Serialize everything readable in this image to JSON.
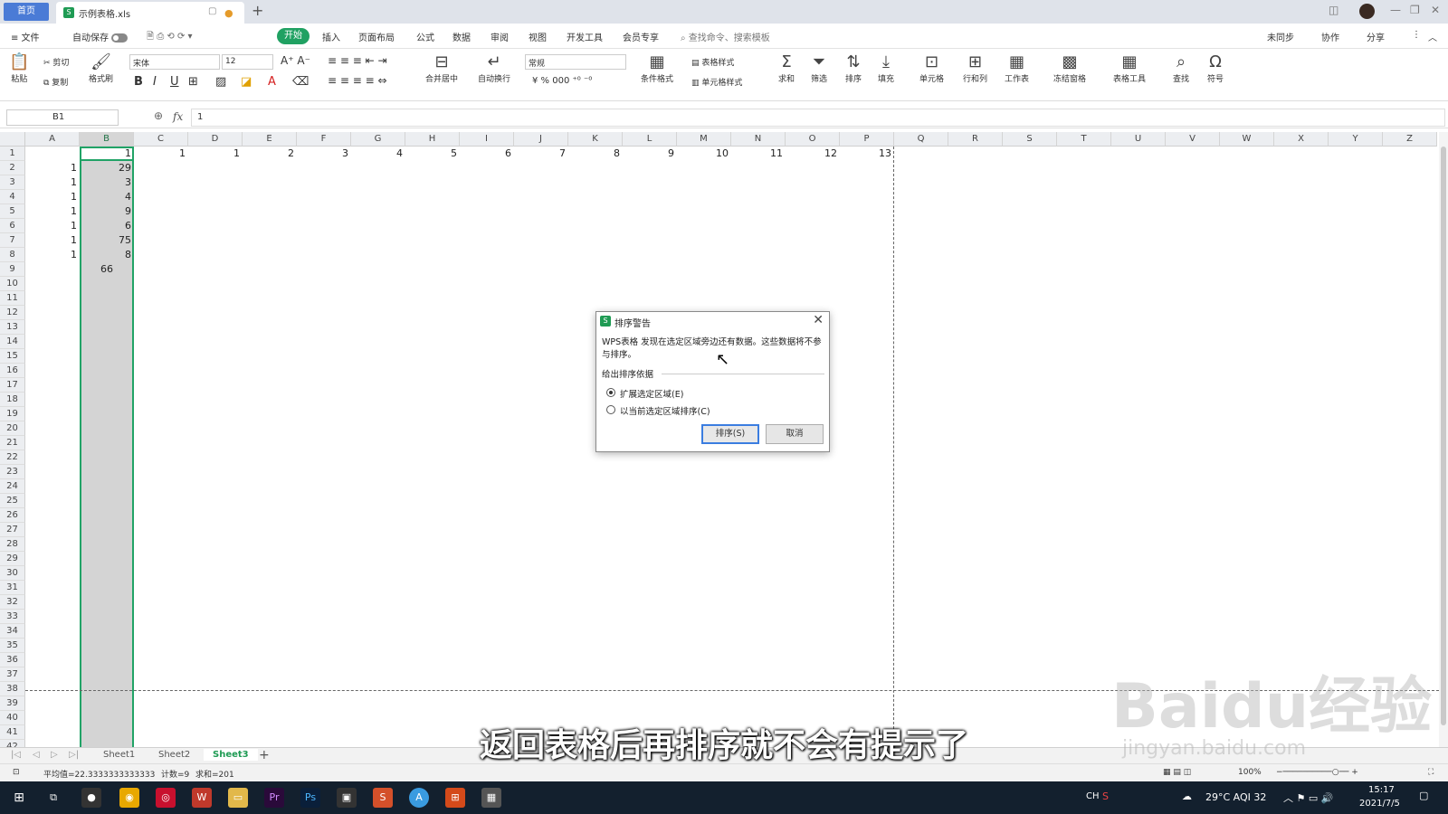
{
  "titlebar": {
    "home_tab": "首页",
    "doc_name": "示例表格.xls",
    "new_tab": "+"
  },
  "menubar": {
    "file": "≡ 文件",
    "autosave": "自动保存",
    "tabs": [
      "开始",
      "插入",
      "页面布局",
      "公式",
      "数据",
      "审阅",
      "视图",
      "开发工具",
      "会员专享"
    ],
    "search": "查找命令、搜索模板",
    "right": [
      "未同步",
      "协作",
      "分享"
    ]
  },
  "ribbon": {
    "paste": "粘贴",
    "cut": "剪切",
    "copy": "复制",
    "format_painter": "格式刷",
    "font": "宋体",
    "size": "12",
    "merge": "合并居中",
    "wrap": "自动换行",
    "number_format": "常规",
    "cond_format": "条件格式",
    "table_style": "表格样式",
    "cell_style": "单元格样式",
    "sum": "求和",
    "filter": "筛选",
    "sort": "排序",
    "fill": "填充",
    "cell": "单元格",
    "rowcol": "行和列",
    "sheet": "工作表",
    "freeze": "冻结窗格",
    "table_tools": "表格工具",
    "find": "查找",
    "symbol": "符号"
  },
  "formula": {
    "cell_ref": "B1",
    "fx": "fx",
    "value": "1"
  },
  "columns": [
    "A",
    "B",
    "C",
    "D",
    "E",
    "F",
    "G",
    "H",
    "I",
    "J",
    "K",
    "L",
    "M",
    "N",
    "O",
    "P",
    "Q",
    "R",
    "S",
    "T",
    "U",
    "V",
    "W",
    "X",
    "Y",
    "Z"
  ],
  "rows": [
    "1",
    "2",
    "3",
    "4",
    "5",
    "6",
    "7",
    "8",
    "9",
    "10",
    "11",
    "12",
    "13",
    "14",
    "15",
    "16",
    "17",
    "18",
    "19",
    "20",
    "21",
    "22",
    "23",
    "24",
    "25",
    "26",
    "27",
    "28",
    "29",
    "30",
    "31",
    "32",
    "33",
    "34",
    "35",
    "36",
    "37",
    "38",
    "39",
    "40",
    "41",
    "42"
  ],
  "cells": {
    "row1": [
      "1",
      "1",
      "1",
      "2",
      "3",
      "4",
      "5",
      "6",
      "7",
      "8",
      "9",
      "10",
      "11",
      "12",
      "13"
    ],
    "colA": [
      "1",
      "1",
      "1",
      "1",
      "1",
      "1",
      "1"
    ],
    "colB": [
      "29",
      "3",
      "4",
      "9",
      "6",
      "75",
      "8",
      "66"
    ]
  },
  "sheets": {
    "tabs": [
      "Sheet1",
      "Sheet2",
      "Sheet3"
    ],
    "active": "Sheet3"
  },
  "status": {
    "avg": "平均值=22.3333333333333",
    "count": "计数=9",
    "sum": "求和=201",
    "zoom": "100%"
  },
  "dialog": {
    "title": "排序警告",
    "message": "WPS表格 发现在选定区域旁边还有数据。这些数据将不参与排序。",
    "group": "给出排序依据",
    "option1": "扩展选定区域(E)",
    "option2": "以当前选定区域排序(C)",
    "sort_btn": "排序(S)",
    "cancel_btn": "取消"
  },
  "taskbar": {
    "weather": "29°C AQI 32",
    "lang": "CH",
    "time": "15:17",
    "date": "2021/7/5"
  },
  "overlay": {
    "subtitle": "返回表格后再排序就不会有提示了",
    "watermark": "Baidu经验",
    "watermark_url": "jingyan.baidu.com"
  }
}
